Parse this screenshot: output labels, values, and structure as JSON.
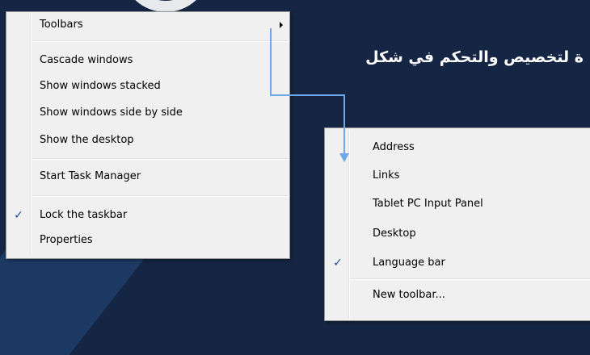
{
  "headline": "ة لتخصيص والتحكم في شكل",
  "accent_color": "#6ea8e8",
  "taskbar_menu": {
    "items": [
      {
        "label": "Toolbars",
        "checked": false,
        "has_submenu": true
      },
      {
        "label": "Cascade windows",
        "checked": false
      },
      {
        "label": "Show windows stacked",
        "checked": false
      },
      {
        "label": "Show windows side by side",
        "checked": false
      },
      {
        "label": "Show the desktop",
        "checked": false
      },
      {
        "label": "Start Task Manager",
        "checked": false
      },
      {
        "label": "Lock the taskbar",
        "checked": true,
        "check_glyph": "✓"
      },
      {
        "label": "Properties",
        "checked": false
      }
    ]
  },
  "toolbars_menu": {
    "items": [
      {
        "label": "Address",
        "checked": false
      },
      {
        "label": "Links",
        "checked": false
      },
      {
        "label": "Tablet PC Input Panel",
        "checked": false
      },
      {
        "label": "Desktop",
        "checked": false
      },
      {
        "label": "Language bar",
        "checked": true,
        "check_glyph": "✓"
      },
      {
        "label": "New toolbar...",
        "checked": false
      }
    ]
  }
}
